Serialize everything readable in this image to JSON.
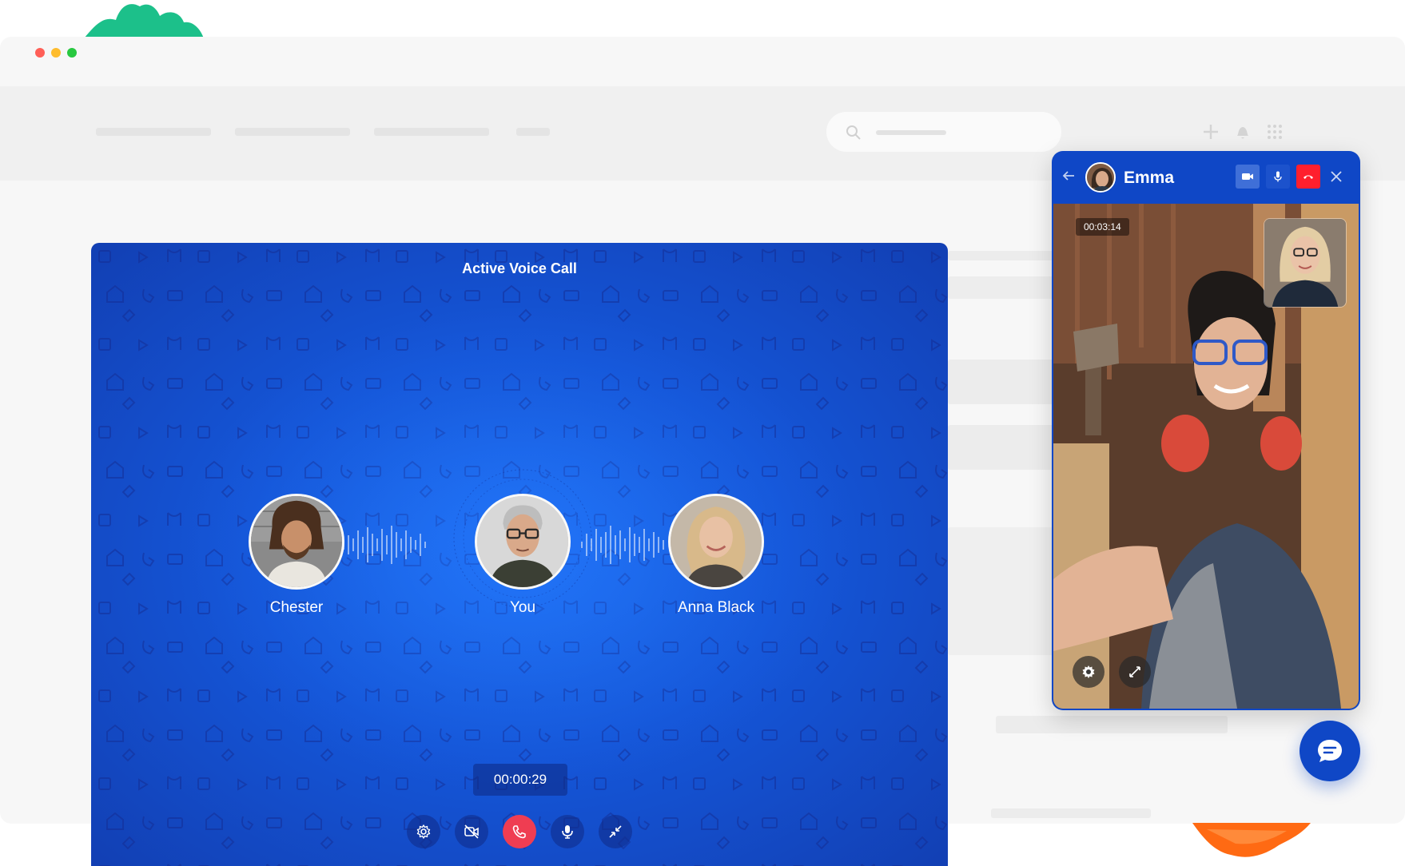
{
  "window": {
    "dot_colors": [
      "#ff5f57",
      "#febc2e",
      "#28c840"
    ]
  },
  "voice_call": {
    "title": "Active Voice Call",
    "participants": [
      {
        "name": "Chester"
      },
      {
        "name": "You"
      },
      {
        "name": "Anna Black"
      }
    ],
    "timer": "00:00:29",
    "controls": [
      "settings-icon",
      "video-off-icon",
      "end-call-icon",
      "microphone-icon",
      "minimize-icon"
    ],
    "background_color": "#1556d8",
    "end_call_color": "#ef3d52"
  },
  "video_call": {
    "contact_name": "Emma",
    "timer": "00:03:14",
    "header_buttons": [
      "video-camera-icon",
      "microphone-icon",
      "hang-up-icon",
      "close-icon"
    ],
    "bottom_buttons": [
      "settings-icon",
      "expand-icon"
    ],
    "accent_color": "#0f47c6",
    "hang_up_color": "#ff1f2d"
  },
  "chat": {
    "icon": "chat-bubble-icon"
  }
}
